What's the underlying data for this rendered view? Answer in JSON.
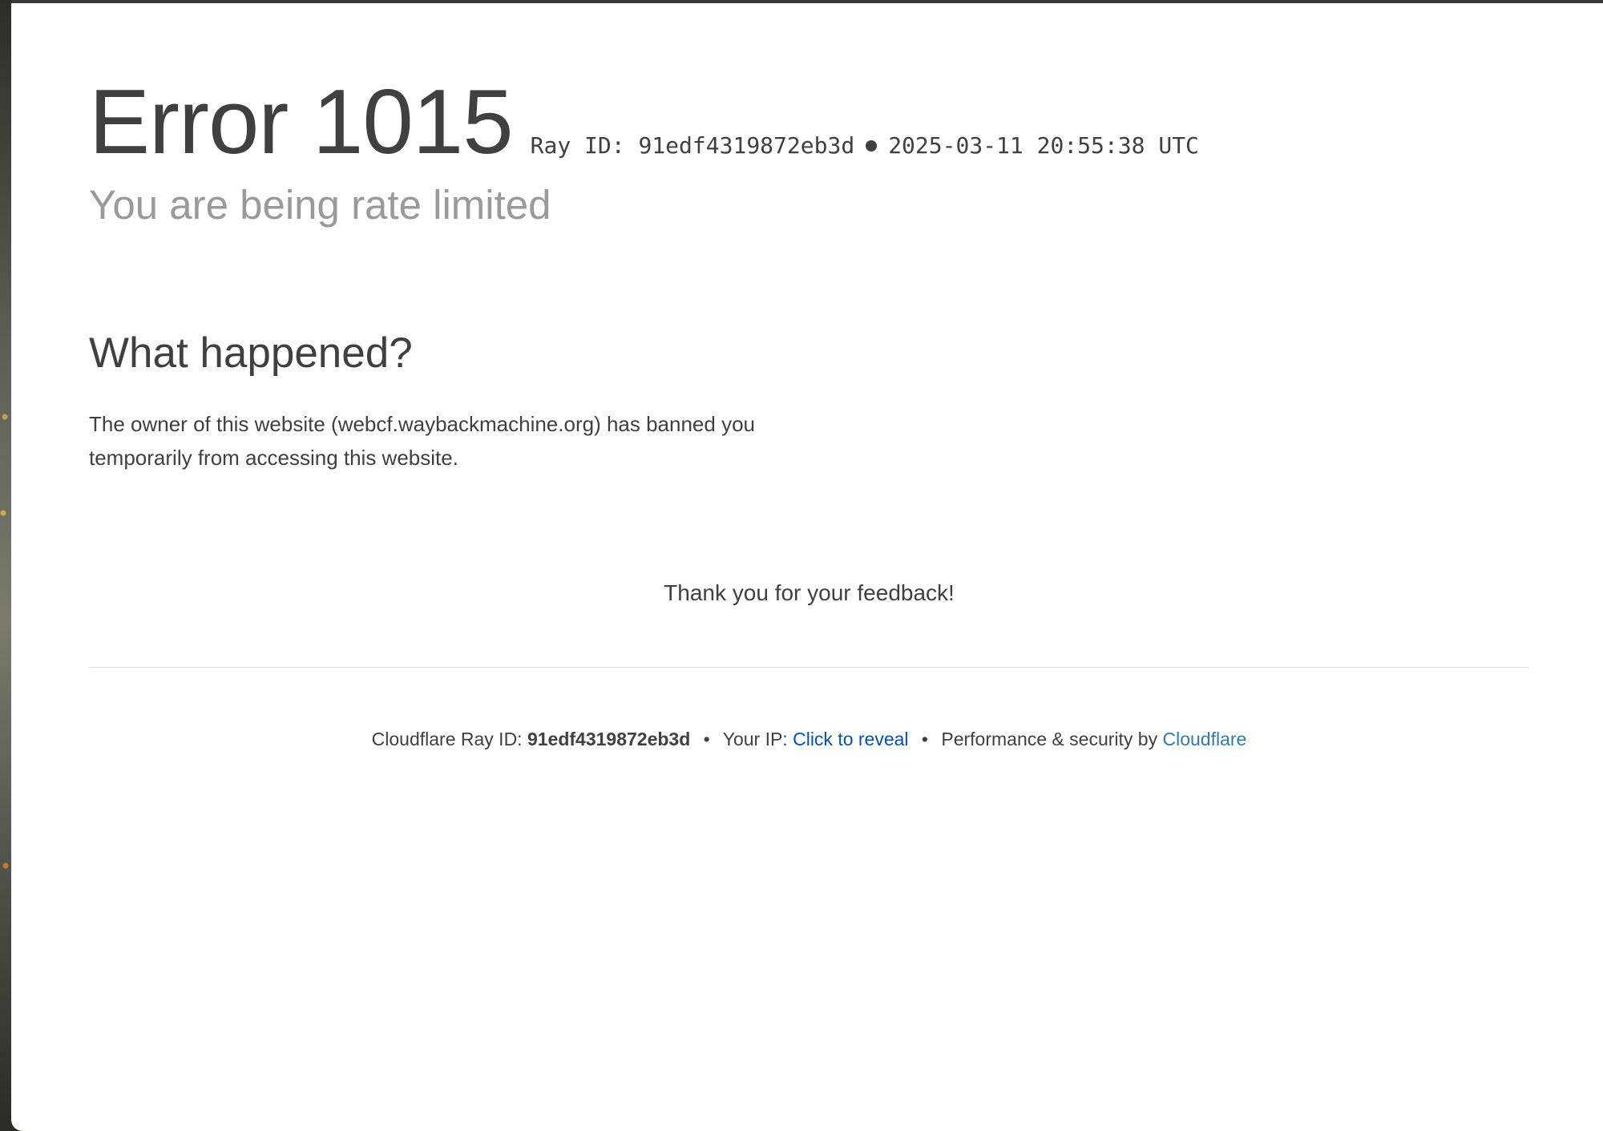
{
  "error": {
    "title": "Error 1015",
    "ray_label": "Ray ID: 91edf4319872eb3d",
    "timestamp": "2025-03-11 20:55:38 UTC",
    "subtitle": "You are being rate limited"
  },
  "what_happened": {
    "heading": "What happened?",
    "body": "The owner of this website (webcf.waybackmachine.org) has banned you temporarily from accessing this website."
  },
  "feedback": {
    "message": "Thank you for your feedback!"
  },
  "footer": {
    "ray_prefix": "Cloudflare Ray ID:",
    "ray_id": "91edf4319872eb3d",
    "separator": "•",
    "ip_prefix": "Your IP:",
    "ip_link": "Click to reveal",
    "perf_prefix": "Performance & security by",
    "brand_link": "Cloudflare"
  },
  "colors": {
    "text": "#404040",
    "subtitle": "#9a9a9a",
    "link": "#0051c3",
    "brand_link": "#2c7cb0"
  }
}
